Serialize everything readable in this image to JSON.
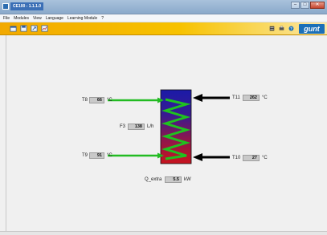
{
  "window": {
    "title": "CE100 - 1.1.1.0",
    "minimize": "–",
    "maximize": "□",
    "close": "✕"
  },
  "menu": [
    "File",
    "Modules",
    "View",
    "Language",
    "Learning Module",
    "?"
  ],
  "toolbar": {
    "left_icons": [
      "open-icon",
      "save-icon",
      "export-icon",
      "chart-icon"
    ],
    "right_icons": [
      "settings-icon",
      "print-icon",
      "help-icon"
    ],
    "logo": "gunt"
  },
  "colors": {
    "hot_inlet": "#22bb22",
    "cold_arrow": "#000000",
    "exchanger_top": "#1a1aa8",
    "exchanger_bottom": "#c8141e",
    "coil": "#1fc21f",
    "toolbar": "#f2a900"
  },
  "sensors": {
    "t8": {
      "label": "T8",
      "value": "66",
      "unit": "°C"
    },
    "t9": {
      "label": "T9",
      "value": "91",
      "unit": "°C"
    },
    "t10": {
      "label": "T10",
      "value": "27",
      "unit": "°C"
    },
    "t11": {
      "label": "T11",
      "value": "262",
      "unit": "°C"
    },
    "f3": {
      "label": "F3",
      "value": "138",
      "unit": "L/h"
    },
    "q": {
      "label": "Q_extra",
      "value": "5.5",
      "unit": "kW"
    }
  }
}
